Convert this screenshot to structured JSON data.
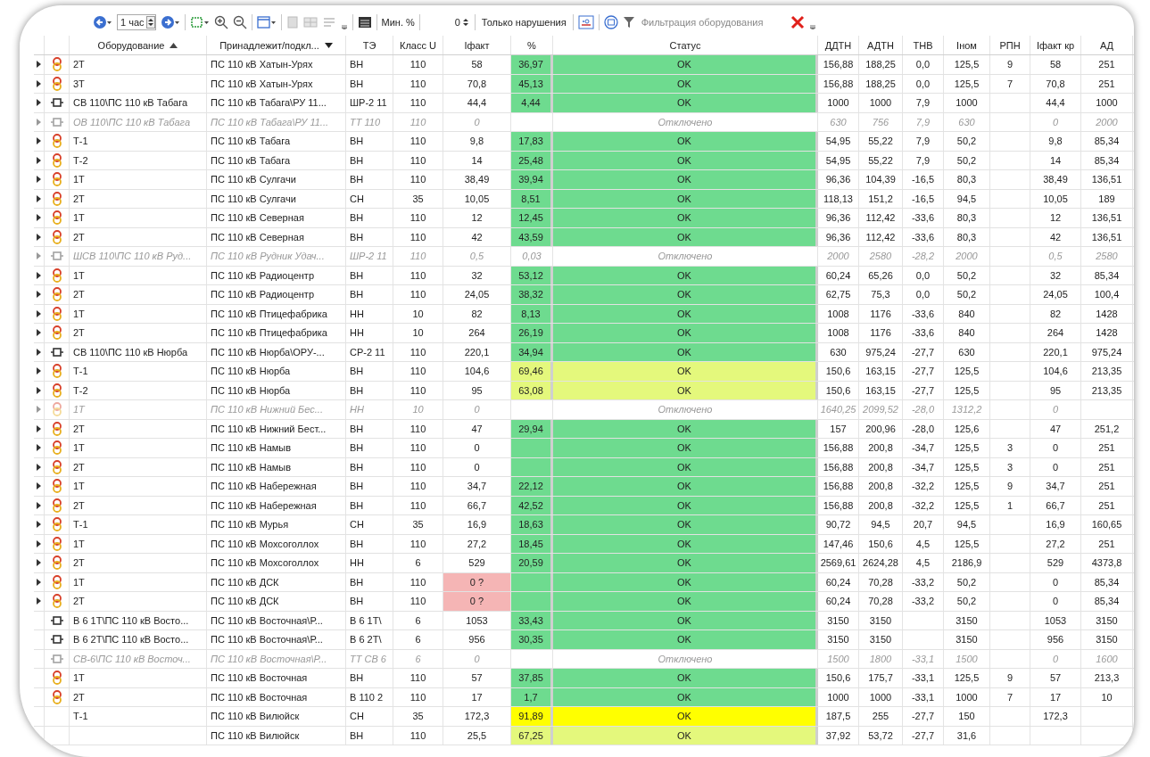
{
  "toolbar": {
    "interval": "1 час",
    "min_label": "Мин. %",
    "min_value": "0",
    "violations_label": "Только нарушения",
    "filter_placeholder": "Фильтрация оборудования"
  },
  "columns": [
    {
      "label": "Оборудование",
      "sorted": true
    },
    {
      "label": "Принадлежит/подкл...",
      "dropdown": true
    },
    {
      "label": "ТЭ"
    },
    {
      "label": "Класс U"
    },
    {
      "label": "Iфакт"
    },
    {
      "label": "%"
    },
    {
      "label": "Статус"
    },
    {
      "label": "ДДТН"
    },
    {
      "label": "АДТН"
    },
    {
      "label": "ТНВ"
    },
    {
      "label": "Iном"
    },
    {
      "label": "РПН"
    },
    {
      "label": "Iфакт кр"
    },
    {
      "label": "АД"
    }
  ],
  "rows": [
    {
      "kind": "transformer",
      "expander": true,
      "disabled": false,
      "name": "2Т",
      "belongs": "ПС 110 кВ Хатын-Урях",
      "te": "ВН",
      "u": "110",
      "ifact": "58",
      "ifact_alarm": false,
      "pct": "36,97",
      "warning": false,
      "overload": false,
      "status": "OK",
      "ddtn": "156,88",
      "adtn": "188,25",
      "tnv": "0,0",
      "inom": "125,5",
      "rpn": "9",
      "ifact_kr": "58",
      "ad": "251"
    },
    {
      "kind": "transformer",
      "expander": true,
      "disabled": false,
      "name": "3Т",
      "belongs": "ПС 110 кВ Хатын-Урях",
      "te": "ВН",
      "u": "110",
      "ifact": "70,8",
      "ifact_alarm": false,
      "pct": "45,13",
      "warning": false,
      "overload": false,
      "status": "OK",
      "ddtn": "156,88",
      "adtn": "188,25",
      "tnv": "0,0",
      "inom": "125,5",
      "rpn": "7",
      "ifact_kr": "70,8",
      "ad": "251"
    },
    {
      "kind": "breaker",
      "expander": true,
      "disabled": false,
      "name": "СВ 110\\ПС 110 кВ Табага",
      "belongs": "ПС 110 кВ Табага\\РУ 11...",
      "te": "ШР-2 11",
      "u": "110",
      "ifact": "44,4",
      "ifact_alarm": false,
      "pct": "4,44",
      "warning": false,
      "overload": false,
      "status": "OK",
      "ddtn": "1000",
      "adtn": "1000",
      "tnv": "7,9",
      "inom": "1000",
      "ifact_kr": "44,4",
      "ad": "1000"
    },
    {
      "kind": "breaker",
      "expander": true,
      "disabled": true,
      "name": "ОВ 110\\ПС 110 кВ Табага",
      "belongs": "ПС 110 кВ Табага\\РУ 11...",
      "te": "ТТ 110",
      "u": "110",
      "ifact": "0",
      "ifact_alarm": false,
      "warning": false,
      "overload": false,
      "status": "Отключено",
      "ddtn": "630",
      "adtn": "756",
      "tnv": "7,9",
      "inom": "630",
      "ifact_kr": "0",
      "ad": "2000"
    },
    {
      "kind": "transformer",
      "expander": true,
      "disabled": false,
      "name": "Т-1",
      "belongs": "ПС 110 кВ Табага",
      "te": "ВН",
      "u": "110",
      "ifact": "9,8",
      "ifact_alarm": false,
      "pct": "17,83",
      "warning": false,
      "overload": false,
      "status": "OK",
      "ddtn": "54,95",
      "adtn": "55,22",
      "tnv": "7,9",
      "inom": "50,2",
      "ifact_kr": "9,8",
      "ad": "85,34"
    },
    {
      "kind": "transformer",
      "expander": true,
      "disabled": false,
      "name": "Т-2",
      "belongs": "ПС 110 кВ Табага",
      "te": "ВН",
      "u": "110",
      "ifact": "14",
      "ifact_alarm": false,
      "pct": "25,48",
      "warning": false,
      "overload": false,
      "status": "OK",
      "ddtn": "54,95",
      "adtn": "55,22",
      "tnv": "7,9",
      "inom": "50,2",
      "ifact_kr": "14",
      "ad": "85,34"
    },
    {
      "kind": "transformer",
      "expander": true,
      "disabled": false,
      "name": "1Т",
      "belongs": "ПС 110 кВ Сулгачи",
      "te": "ВН",
      "u": "110",
      "ifact": "38,49",
      "ifact_alarm": false,
      "pct": "39,94",
      "warning": false,
      "overload": false,
      "status": "OK",
      "ddtn": "96,36",
      "adtn": "104,39",
      "tnv": "-16,5",
      "inom": "80,3",
      "ifact_kr": "38,49",
      "ad": "136,51"
    },
    {
      "kind": "transformer",
      "expander": true,
      "disabled": false,
      "name": "2Т",
      "belongs": "ПС 110 кВ Сулгачи",
      "te": "СН",
      "u": "35",
      "ifact": "10,05",
      "ifact_alarm": false,
      "pct": "8,51",
      "warning": false,
      "overload": false,
      "status": "OK",
      "ddtn": "118,13",
      "adtn": "151,2",
      "tnv": "-16,5",
      "inom": "94,5",
      "ifact_kr": "10,05",
      "ad": "189"
    },
    {
      "kind": "transformer",
      "expander": true,
      "disabled": false,
      "name": "1Т",
      "belongs": "ПС 110 кВ Северная",
      "te": "ВН",
      "u": "110",
      "ifact": "12",
      "ifact_alarm": false,
      "pct": "12,45",
      "warning": false,
      "overload": false,
      "status": "OK",
      "ddtn": "96,36",
      "adtn": "112,42",
      "tnv": "-33,6",
      "inom": "80,3",
      "ifact_kr": "12",
      "ad": "136,51"
    },
    {
      "kind": "transformer",
      "expander": true,
      "disabled": false,
      "name": "2Т",
      "belongs": "ПС 110 кВ Северная",
      "te": "ВН",
      "u": "110",
      "ifact": "42",
      "ifact_alarm": false,
      "pct": "43,59",
      "warning": false,
      "overload": false,
      "status": "OK",
      "ddtn": "96,36",
      "adtn": "112,42",
      "tnv": "-33,6",
      "inom": "80,3",
      "ifact_kr": "42",
      "ad": "136,51"
    },
    {
      "kind": "breaker",
      "expander": true,
      "disabled": true,
      "name": "ШСВ 110\\ПС 110 кВ Руд...",
      "belongs": "ПС 110 кВ Рудник Удач...",
      "te": "ШР-2 11",
      "u": "110",
      "ifact": "0,5",
      "ifact_alarm": false,
      "pct": "0,03",
      "warning": false,
      "overload": false,
      "status": "Отключено",
      "ddtn": "2000",
      "adtn": "2580",
      "tnv": "-28,2",
      "inom": "2000",
      "ifact_kr": "0,5",
      "ad": "2580"
    },
    {
      "kind": "transformer",
      "expander": true,
      "disabled": false,
      "name": "1Т",
      "belongs": "ПС 110 кВ Радиоцентр",
      "te": "ВН",
      "u": "110",
      "ifact": "32",
      "ifact_alarm": false,
      "pct": "53,12",
      "warning": false,
      "overload": false,
      "status": "OK",
      "ddtn": "60,24",
      "adtn": "65,26",
      "tnv": "0,0",
      "inom": "50,2",
      "ifact_kr": "32",
      "ad": "85,34"
    },
    {
      "kind": "transformer",
      "expander": true,
      "disabled": false,
      "name": "2Т",
      "belongs": "ПС 110 кВ Радиоцентр",
      "te": "ВН",
      "u": "110",
      "ifact": "24,05",
      "ifact_alarm": false,
      "pct": "38,32",
      "warning": false,
      "overload": false,
      "status": "OK",
      "ddtn": "62,75",
      "adtn": "75,3",
      "tnv": "0,0",
      "inom": "50,2",
      "ifact_kr": "24,05",
      "ad": "100,4"
    },
    {
      "kind": "transformer",
      "expander": true,
      "disabled": false,
      "name": "1Т",
      "belongs": "ПС 110 кВ Птицефабрика",
      "te": "НН",
      "u": "10",
      "ifact": "82",
      "ifact_alarm": false,
      "pct": "8,13",
      "warning": false,
      "overload": false,
      "status": "OK",
      "ddtn": "1008",
      "adtn": "1176",
      "tnv": "-33,6",
      "inom": "840",
      "ifact_kr": "82",
      "ad": "1428"
    },
    {
      "kind": "transformer",
      "expander": true,
      "disabled": false,
      "name": "2Т",
      "belongs": "ПС 110 кВ Птицефабрика",
      "te": "НН",
      "u": "10",
      "ifact": "264",
      "ifact_alarm": false,
      "pct": "26,19",
      "warning": false,
      "overload": false,
      "status": "OK",
      "ddtn": "1008",
      "adtn": "1176",
      "tnv": "-33,6",
      "inom": "840",
      "ifact_kr": "264",
      "ad": "1428"
    },
    {
      "kind": "breaker",
      "expander": true,
      "disabled": false,
      "name": "СВ 110\\ПС 110 кВ Нюрба",
      "belongs": "ПС 110 кВ Нюрба\\ОРУ-...",
      "te": "СР-2 11",
      "u": "110",
      "ifact": "220,1",
      "ifact_alarm": false,
      "pct": "34,94",
      "warning": false,
      "overload": false,
      "status": "OK",
      "ddtn": "630",
      "adtn": "975,24",
      "tnv": "-27,7",
      "inom": "630",
      "ifact_kr": "220,1",
      "ad": "975,24"
    },
    {
      "kind": "transformer",
      "expander": true,
      "disabled": false,
      "name": "Т-1",
      "belongs": "ПС 110 кВ Нюрба",
      "te": "ВН",
      "u": "110",
      "ifact": "104,6",
      "ifact_alarm": false,
      "pct": "69,46",
      "warning": true,
      "overload": false,
      "status": "OK",
      "ddtn": "150,6",
      "adtn": "163,15",
      "tnv": "-27,7",
      "inom": "125,5",
      "ifact_kr": "104,6",
      "ad": "213,35"
    },
    {
      "kind": "transformer",
      "expander": true,
      "disabled": false,
      "name": "Т-2",
      "belongs": "ПС 110 кВ Нюрба",
      "te": "ВН",
      "u": "110",
      "ifact": "95",
      "ifact_alarm": false,
      "pct": "63,08",
      "warning": true,
      "overload": false,
      "status": "OK",
      "ddtn": "150,6",
      "adtn": "163,15",
      "tnv": "-27,7",
      "inom": "125,5",
      "ifact_kr": "95",
      "ad": "213,35"
    },
    {
      "kind": "transformer",
      "expander": true,
      "disabled": true,
      "name": "1Т",
      "belongs": "ПС 110 кВ Нижний Бес...",
      "te": "НН",
      "u": "10",
      "ifact": "0",
      "ifact_alarm": false,
      "warning": false,
      "overload": false,
      "status": "Отключено",
      "ddtn": "1640,25",
      "adtn": "2099,52",
      "tnv": "-28,0",
      "inom": "1312,2",
      "ifact_kr": "0"
    },
    {
      "kind": "transformer",
      "expander": true,
      "disabled": false,
      "name": "2Т",
      "belongs": "ПС 110 кВ Нижний Бест...",
      "te": "ВН",
      "u": "110",
      "ifact": "47",
      "ifact_alarm": false,
      "pct": "29,94",
      "warning": false,
      "overload": false,
      "status": "OK",
      "ddtn": "157",
      "adtn": "200,96",
      "tnv": "-28,0",
      "inom": "125,6",
      "ifact_kr": "47",
      "ad": "251,2"
    },
    {
      "kind": "transformer",
      "expander": true,
      "disabled": false,
      "name": "1Т",
      "belongs": "ПС 110 кВ Намыв",
      "te": "ВН",
      "u": "110",
      "ifact": "0",
      "ifact_alarm": false,
      "warning": false,
      "overload": false,
      "status": "OK",
      "ddtn": "156,88",
      "adtn": "200,8",
      "tnv": "-34,7",
      "inom": "125,5",
      "rpn": "3",
      "ifact_kr": "0",
      "ad": "251"
    },
    {
      "kind": "transformer",
      "expander": true,
      "disabled": false,
      "name": "2Т",
      "belongs": "ПС 110 кВ Намыв",
      "te": "ВН",
      "u": "110",
      "ifact": "0",
      "ifact_alarm": false,
      "warning": false,
      "overload": false,
      "status": "OK",
      "ddtn": "156,88",
      "adtn": "200,8",
      "tnv": "-34,7",
      "inom": "125,5",
      "rpn": "3",
      "ifact_kr": "0",
      "ad": "251"
    },
    {
      "kind": "transformer",
      "expander": true,
      "disabled": false,
      "name": "1Т",
      "belongs": "ПС 110 кВ Набережная",
      "te": "ВН",
      "u": "110",
      "ifact": "34,7",
      "ifact_alarm": false,
      "pct": "22,12",
      "warning": false,
      "overload": false,
      "status": "OK",
      "ddtn": "156,88",
      "adtn": "200,8",
      "tnv": "-32,2",
      "inom": "125,5",
      "rpn": "9",
      "ifact_kr": "34,7",
      "ad": "251"
    },
    {
      "kind": "transformer",
      "expander": true,
      "disabled": false,
      "name": "2Т",
      "belongs": "ПС 110 кВ Набережная",
      "te": "ВН",
      "u": "110",
      "ifact": "66,7",
      "ifact_alarm": false,
      "pct": "42,52",
      "warning": false,
      "overload": false,
      "status": "OK",
      "ddtn": "156,88",
      "adtn": "200,8",
      "tnv": "-32,2",
      "inom": "125,5",
      "rpn": "1",
      "ifact_kr": "66,7",
      "ad": "251"
    },
    {
      "kind": "transformer",
      "expander": true,
      "disabled": false,
      "name": "Т-1",
      "belongs": "ПС 110 кВ Мурья",
      "te": "СН",
      "u": "35",
      "ifact": "16,9",
      "ifact_alarm": false,
      "pct": "18,63",
      "warning": false,
      "overload": false,
      "status": "OK",
      "ddtn": "90,72",
      "adtn": "94,5",
      "tnv": "20,7",
      "inom": "94,5",
      "ifact_kr": "16,9",
      "ad": "160,65"
    },
    {
      "kind": "transformer",
      "expander": true,
      "disabled": false,
      "name": "1Т",
      "belongs": "ПС 110 кВ Мохсоголлох",
      "te": "ВН",
      "u": "110",
      "ifact": "27,2",
      "ifact_alarm": false,
      "pct": "18,45",
      "warning": false,
      "overload": false,
      "status": "OK",
      "ddtn": "147,46",
      "adtn": "150,6",
      "tnv": "4,5",
      "inom": "125,5",
      "ifact_kr": "27,2",
      "ad": "251"
    },
    {
      "kind": "transformer",
      "expander": true,
      "disabled": false,
      "name": "2Т",
      "belongs": "ПС 110 кВ Мохсоголлох",
      "te": "НН",
      "u": "6",
      "ifact": "529",
      "ifact_alarm": false,
      "pct": "20,59",
      "warning": false,
      "overload": false,
      "status": "OK",
      "ddtn": "2569,61",
      "adtn": "2624,28",
      "tnv": "4,5",
      "inom": "2186,9",
      "ifact_kr": "529",
      "ad": "4373,8"
    },
    {
      "kind": "transformer",
      "expander": true,
      "disabled": false,
      "name": "1Т",
      "belongs": "ПС 110 кВ ДСК",
      "te": "ВН",
      "u": "110",
      "ifact": "0 ?",
      "ifact_alarm": true,
      "warning": false,
      "overload": false,
      "status": "OK",
      "ddtn": "60,24",
      "adtn": "70,28",
      "tnv": "-33,2",
      "inom": "50,2",
      "ifact_kr": "0",
      "ad": "85,34"
    },
    {
      "kind": "transformer",
      "expander": true,
      "disabled": false,
      "name": "2Т",
      "belongs": "ПС 110 кВ ДСК",
      "te": "ВН",
      "u": "110",
      "ifact": "0 ?",
      "ifact_alarm": true,
      "warning": false,
      "overload": false,
      "status": "OK",
      "ddtn": "60,24",
      "adtn": "70,28",
      "tnv": "-33,2",
      "inom": "50,2",
      "ifact_kr": "0",
      "ad": "85,34"
    },
    {
      "kind": "breaker",
      "expander": false,
      "disabled": false,
      "name": "В 6 1Т\\ПС 110 кВ Восто...",
      "belongs": "ПС 110 кВ Восточная\\Р...",
      "te": "В 6 1Т\\",
      "u": "6",
      "ifact": "1053",
      "ifact_alarm": false,
      "pct": "33,43",
      "warning": false,
      "overload": false,
      "status": "OK",
      "ddtn": "3150",
      "adtn": "3150",
      "inom": "3150",
      "ifact_kr": "1053",
      "ad": "3150"
    },
    {
      "kind": "breaker",
      "expander": false,
      "disabled": false,
      "name": "В 6 2Т\\ПС 110 кВ Восто...",
      "belongs": "ПС 110 кВ Восточная\\Р...",
      "te": "В 6 2Т\\",
      "u": "6",
      "ifact": "956",
      "ifact_alarm": false,
      "pct": "30,35",
      "warning": false,
      "overload": false,
      "status": "OK",
      "ddtn": "3150",
      "adtn": "3150",
      "inom": "3150",
      "ifact_kr": "956",
      "ad": "3150"
    },
    {
      "kind": "breaker",
      "expander": false,
      "disabled": true,
      "name": "СВ-6\\ПС 110 кВ Восточ...",
      "belongs": "ПС 110 кВ Восточная\\Р...",
      "te": "ТТ СВ 6",
      "u": "6",
      "ifact": "0",
      "ifact_alarm": false,
      "warning": false,
      "overload": false,
      "status": "Отключено",
      "ddtn": "1500",
      "adtn": "1800",
      "tnv": "-33,1",
      "inom": "1500",
      "ifact_kr": "0",
      "ad": "1600"
    },
    {
      "kind": "transformer",
      "expander": false,
      "disabled": false,
      "name": "1Т",
      "belongs": "ПС 110 кВ Восточная",
      "te": "ВН",
      "u": "110",
      "ifact": "57",
      "ifact_alarm": false,
      "pct": "37,85",
      "warning": false,
      "overload": false,
      "status": "OK",
      "ddtn": "150,6",
      "adtn": "175,7",
      "tnv": "-33,1",
      "inom": "125,5",
      "rpn": "9",
      "ifact_kr": "57",
      "ad": "213,3"
    },
    {
      "kind": "transformer",
      "expander": false,
      "disabled": false,
      "name": "2Т",
      "belongs": "ПС 110 кВ Восточная",
      "te": "В 110 2",
      "u": "110",
      "ifact": "17",
      "ifact_alarm": false,
      "pct": "1,7",
      "warning": false,
      "overload": false,
      "status": "OK",
      "ddtn": "1000",
      "adtn": "1000",
      "tnv": "-33,1",
      "inom": "1000",
      "rpn": "7",
      "ifact_kr": "17",
      "ad": "10"
    },
    {
      "kind": "none",
      "expander": false,
      "disabled": false,
      "name": "Т-1",
      "belongs": "ПС 110 кВ Вилюйск",
      "te": "СН",
      "u": "35",
      "ifact": "172,3",
      "ifact_alarm": false,
      "pct": "91,89",
      "warning": false,
      "overload": true,
      "status": "OK",
      "ddtn": "187,5",
      "adtn": "255",
      "tnv": "-27,7",
      "inom": "150",
      "ifact_kr": "172,3"
    },
    {
      "kind": "none",
      "expander": false,
      "disabled": false,
      "belongs": "ПС 110 кВ Вилюйск",
      "te": "ВН",
      "u": "110",
      "ifact": "25,5",
      "ifact_alarm": false,
      "pct": "67,25",
      "warning": true,
      "overload": false,
      "status": "OK",
      "ddtn": "37,92",
      "adtn": "53,72",
      "tnv": "-27,7",
      "inom": "31,6"
    }
  ]
}
